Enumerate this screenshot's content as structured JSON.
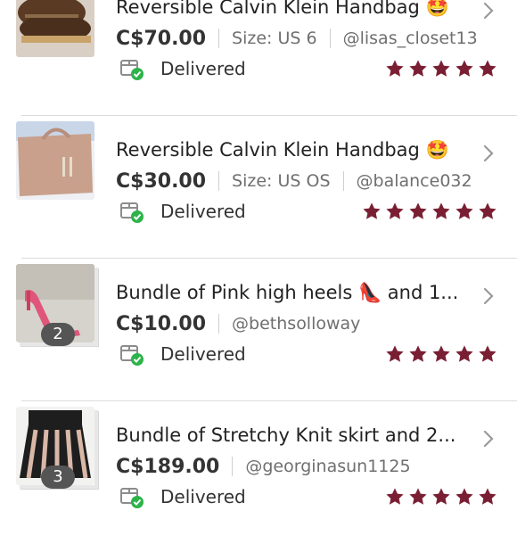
{
  "orders": [
    {
      "title": "Reversible Calvin Klein Handbag 🤩",
      "price": "C$70.00",
      "size": "Size: US 6",
      "seller": "@lisas_closet13",
      "status": "Delivered",
      "rating": 5,
      "bundle_count": null
    },
    {
      "title": "Reversible Calvin Klein Handbag 🤩",
      "price": "C$30.00",
      "size": "Size: US OS",
      "seller": "@balance032",
      "status": "Delivered",
      "rating": 5,
      "bundle_count": null
    },
    {
      "title": "Bundle of Pink high heels 👠 and 1...",
      "price": "C$10.00",
      "size": null,
      "seller": "@bethsolloway",
      "status": "Delivered",
      "rating": 5,
      "bundle_count": "2"
    },
    {
      "title": "Bundle of Stretchy Knit skirt and 2...",
      "price": "C$189.00",
      "size": null,
      "seller": "@georginasun1125",
      "status": "Delivered",
      "rating": 5,
      "bundle_count": "3"
    }
  ],
  "colors": {
    "star": "#7a1f33",
    "delivered_check": "#2db34a"
  }
}
